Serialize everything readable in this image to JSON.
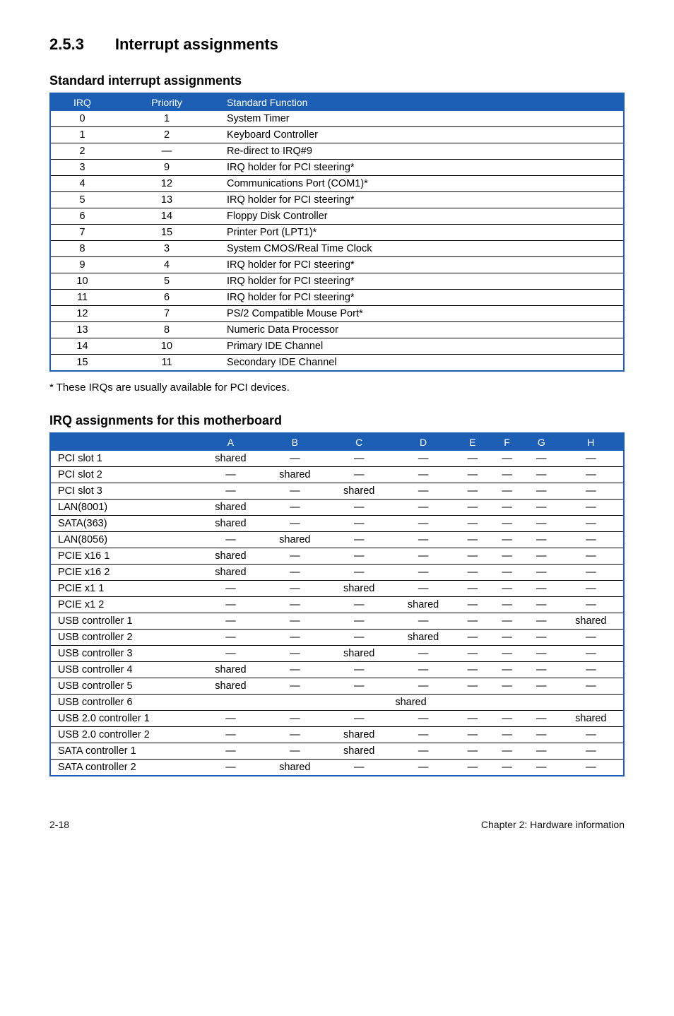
{
  "section": {
    "num": "2.5.3",
    "title": "Interrupt assignments"
  },
  "sub1": "Standard interrupt assignments",
  "t1": {
    "headers": {
      "irq": "IRQ",
      "prio": "Priority",
      "func": "Standard Function"
    },
    "rows": [
      {
        "irq": "0",
        "prio": "1",
        "func": "System Timer"
      },
      {
        "irq": "1",
        "prio": "2",
        "func": "Keyboard Controller"
      },
      {
        "irq": "2",
        "prio": "—",
        "func": "Re-direct to IRQ#9"
      },
      {
        "irq": "3",
        "prio": "9",
        "func": "IRQ holder for PCI steering*"
      },
      {
        "irq": "4",
        "prio": "12",
        "func": "Communications Port (COM1)*"
      },
      {
        "irq": "5",
        "prio": "13",
        "func": "IRQ holder for PCI steering*"
      },
      {
        "irq": "6",
        "prio": "14",
        "func": "Floppy Disk Controller"
      },
      {
        "irq": "7",
        "prio": "15",
        "func": "Printer Port (LPT1)*"
      },
      {
        "irq": "8",
        "prio": "3",
        "func": "System CMOS/Real Time Clock"
      },
      {
        "irq": "9",
        "prio": "4",
        "func": "IRQ holder for PCI steering*"
      },
      {
        "irq": "10",
        "prio": "5",
        "func": "IRQ holder for PCI steering*"
      },
      {
        "irq": "11",
        "prio": "6",
        "func": "IRQ holder for PCI steering*"
      },
      {
        "irq": "12",
        "prio": "7",
        "func": "PS/2 Compatible Mouse Port*"
      },
      {
        "irq": "13",
        "prio": "8",
        "func": "Numeric Data Processor"
      },
      {
        "irq": "14",
        "prio": "10",
        "func": "Primary IDE Channel"
      },
      {
        "irq": "15",
        "prio": "11",
        "func": "Secondary IDE Channel"
      }
    ]
  },
  "note": "* These IRQs are usually available for PCI devices.",
  "sub2": "IRQ assignments for this motherboard",
  "t2": {
    "headers": [
      "",
      "A",
      "B",
      "C",
      "D",
      "E",
      "F",
      "G",
      "H"
    ],
    "shared": "shared",
    "dash": "—",
    "rows": [
      {
        "label": "PCI slot 1",
        "cells": [
          "shared",
          "—",
          "—",
          "—",
          "—",
          "—",
          "—",
          "—"
        ]
      },
      {
        "label": "PCI slot 2",
        "cells": [
          "—",
          "shared",
          "—",
          "—",
          "—",
          "—",
          "—",
          "—"
        ]
      },
      {
        "label": "PCI slot 3",
        "cells": [
          "—",
          "—",
          "shared",
          "—",
          "—",
          "—",
          "—",
          "—"
        ]
      },
      {
        "label": "LAN(8001)",
        "cells": [
          "shared",
          "—",
          "—",
          "—",
          "—",
          "—",
          "—",
          "—"
        ]
      },
      {
        "label": "SATA(363)",
        "cells": [
          "shared",
          "—",
          "—",
          "—",
          "—",
          "—",
          "—",
          "—"
        ]
      },
      {
        "label": "LAN(8056)",
        "cells": [
          "—",
          "shared",
          "—",
          "—",
          "—",
          "—",
          "—",
          "—"
        ]
      },
      {
        "label": "PCIE x16 1",
        "cells": [
          "shared",
          "—",
          "—",
          "—",
          "—",
          "—",
          "—",
          "—"
        ]
      },
      {
        "label": "PCIE x16 2",
        "cells": [
          "shared",
          "—",
          "—",
          "—",
          "—",
          "—",
          "—",
          "—"
        ]
      },
      {
        "label": "PCIE x1 1",
        "cells": [
          "—",
          "—",
          "shared",
          "—",
          "—",
          "—",
          "—",
          "—"
        ]
      },
      {
        "label": "PCIE x1 2",
        "cells": [
          "—",
          "—",
          "—",
          "shared",
          "—",
          "—",
          "—",
          "—"
        ]
      },
      {
        "label": "USB controller 1",
        "cells": [
          "—",
          "—",
          "—",
          "—",
          "—",
          "—",
          "—",
          "shared"
        ]
      },
      {
        "label": "USB controller 2",
        "cells": [
          "—",
          "—",
          "—",
          "shared",
          "—",
          "—",
          "—",
          "—"
        ]
      },
      {
        "label": "USB controller 3",
        "cells": [
          "—",
          "—",
          "shared",
          "—",
          "—",
          "—",
          "—",
          "—"
        ]
      },
      {
        "label": "USB controller 4",
        "cells": [
          "shared",
          "—",
          "—",
          "—",
          "—",
          "—",
          "—",
          "—"
        ]
      },
      {
        "label": "USB controller 5",
        "cells": [
          "shared",
          "—",
          "—",
          "—",
          "—",
          "—",
          "—",
          "—"
        ]
      },
      {
        "label": "USB controller 6",
        "span": "shared"
      },
      {
        "label": "USB 2.0 controller 1",
        "cells": [
          "—",
          "—",
          "—",
          "—",
          "—",
          "—",
          "—",
          "shared"
        ]
      },
      {
        "label": "USB 2.0 controller 2",
        "cells": [
          "—",
          "—",
          "shared",
          "—",
          "—",
          "—",
          "—",
          "—"
        ]
      },
      {
        "label": "SATA controller 1",
        "cells": [
          "—",
          "—",
          "shared",
          "—",
          "—",
          "—",
          "—",
          "—"
        ]
      },
      {
        "label": "SATA controller 2",
        "cells": [
          "—",
          "shared",
          "—",
          "—",
          "—",
          "—",
          "—",
          "—"
        ]
      }
    ]
  },
  "footer": {
    "left": "2-18",
    "right": "Chapter 2: Hardware information"
  }
}
